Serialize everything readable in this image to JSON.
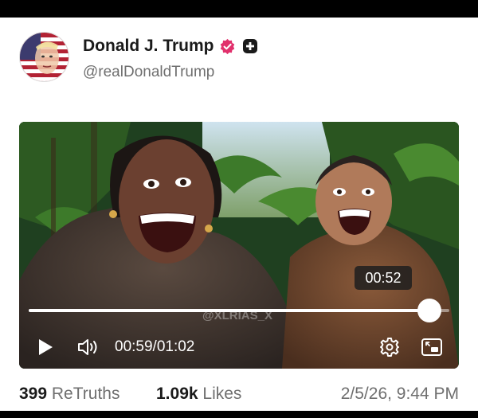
{
  "post": {
    "display_name": "Donald J. Trump",
    "handle": "@realDonaldTrump",
    "verified_icon": "verified-badge-icon",
    "account_badge_icon": "plus-badge-icon"
  },
  "video": {
    "hover_time": "00:52",
    "current_time": "00:59",
    "separator": "/",
    "duration": "01:02",
    "progress": 0.952,
    "watermark": "@XLRIAS_X",
    "accent": "#ffffff"
  },
  "stats": {
    "retruths_count": "399",
    "retruths_label": "ReTruths",
    "likes_count": "1.09k",
    "likes_label": "Likes",
    "timestamp": "2/5/26, 9:44 PM"
  },
  "colors": {
    "verified": "#e1306c",
    "text_primary": "#1a1a1a",
    "text_secondary": "#6f6f6f"
  }
}
